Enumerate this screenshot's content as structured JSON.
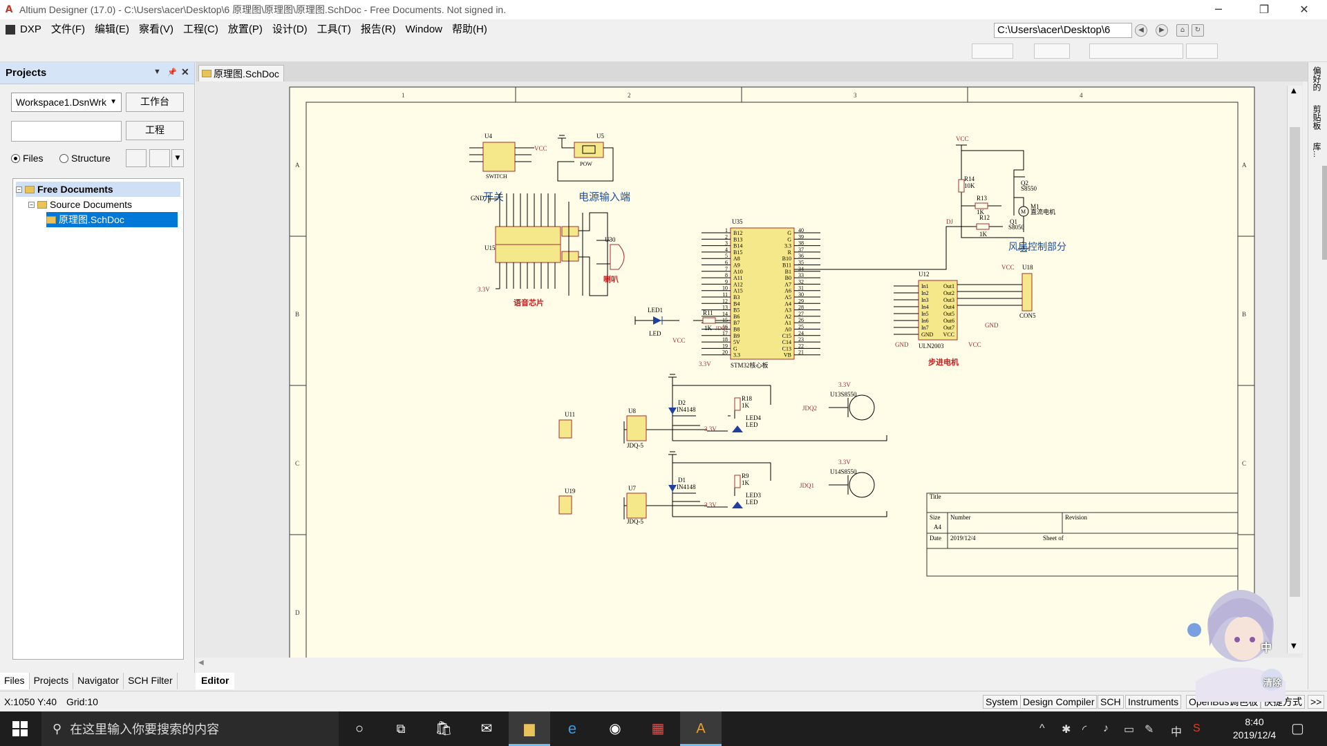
{
  "window": {
    "title": "Altium Designer (17.0) - C:\\Users\\acer\\Desktop\\6 原理图\\原理图\\原理图.SchDoc - Free Documents. Not signed in.",
    "controls": [
      "─",
      "❐",
      "✕"
    ]
  },
  "menu": {
    "dxp": "DXP",
    "items": [
      "文件(F)",
      "编辑(E)",
      "察看(V)",
      "工程(C)",
      "放置(P)",
      "设计(D)",
      "工具(T)",
      "报告(R)",
      "Window",
      "帮助(H)"
    ]
  },
  "path_combo": "C:\\Users\\acer\\Desktop\\6",
  "projects_panel": {
    "title": "Projects",
    "workspace": "Workspace1.DsnWrk",
    "workspace_button": "工作台",
    "project_button": "工程",
    "radio_files": "Files",
    "radio_structure": "Structure",
    "tree": [
      {
        "label": "Free Documents",
        "level": 0
      },
      {
        "label": "Source Documents",
        "level": 1
      },
      {
        "label": "原理图.SchDoc",
        "level": 2
      }
    ],
    "bottom_tabs": [
      "Files",
      "Projects",
      "Navigator",
      "SCH Filter"
    ]
  },
  "document": {
    "tab": "原理图.SchDoc",
    "editor_tab": "Editor",
    "zone_columns": [
      "1",
      "2",
      "3",
      "4"
    ],
    "zone_rows": [
      "A",
      "B",
      "C",
      "D"
    ]
  },
  "right_dock": {
    "tabs": [
      "偏好的",
      "剪贴板",
      "库..."
    ]
  },
  "schematic": {
    "labels": {
      "switch_caption": "开关",
      "power_caption": "电源输入端",
      "voice_caption": "语音芯片",
      "speaker_caption": "喇叭",
      "fan_caption": "风扇控制部分",
      "stepper_caption": "步进电机",
      "mcu_caption": "STM32核心板",
      "u4": "U4",
      "switch": "SWITCH",
      "vcc": "VCC",
      "u5": "U5",
      "pow": "POW",
      "gnd": "GND",
      "v33": "3.3V",
      "u15": "U15",
      "u30": "U30",
      "u35": "U35",
      "u12": "U12",
      "uln": "ULN2003",
      "u18": "U18",
      "con5": "CON5",
      "r14": "R14",
      "r14v": "10K",
      "r13": "R13",
      "r13v": "1K",
      "r12": "R12",
      "r12v": "1K",
      "q2": "Q2",
      "q2v": "S8550",
      "q1": "Q1",
      "q1v": "S8050",
      "m1": "M1",
      "m1v": "直流电机",
      "dj": "DJ",
      "led1": "LED1",
      "led": "LED",
      "r11": "R11",
      "r11v": "1K",
      "jdq1": "JDQ1",
      "jdq2": "JDQ2",
      "d2": "D2",
      "d1": "D1",
      "in4148": "IN4148",
      "r18": "R18",
      "r9": "R9",
      "r1k": "1K",
      "led4": "LED4",
      "led3": "LED3",
      "u13": "U13S8550",
      "u14": "U14S8550",
      "u8": "U8",
      "u7": "U7",
      "jdq5": "JDQ-5",
      "u11": "U11",
      "u19": "U19",
      "title": "Title",
      "size": "Size",
      "a4": "A4",
      "number": "Number",
      "revision": "Revision",
      "date": "Date",
      "date_val": "2019/12/4",
      "sheet": "Sheet  of"
    },
    "mcu_left_pins": [
      "B12",
      "B13",
      "B14",
      "B15",
      "A8",
      "A9",
      "A10",
      "A11",
      "A12",
      "A15",
      "B3",
      "B4",
      "B5",
      "B6",
      "B7",
      "B8",
      "B9",
      "5V",
      "G",
      "3.3"
    ],
    "mcu_right_pins": [
      "G",
      "G",
      "3.3",
      "R",
      "B10",
      "B11",
      "B1",
      "B0",
      "A7",
      "A6",
      "A5",
      "A4",
      "A3",
      "A2",
      "A1",
      "A0",
      "C15",
      "C14",
      "C13",
      "VB"
    ],
    "uln_left_pins": [
      "In1",
      "In2",
      "In3",
      "In4",
      "In5",
      "In6",
      "In7",
      "GND"
    ],
    "uln_right_pins": [
      "Out1",
      "Out2",
      "Out3",
      "Out4",
      "Out5",
      "Out6",
      "Out7",
      "VCC"
    ]
  },
  "status": {
    "coords": "X:1050 Y:40",
    "grid": "Grid:10",
    "tabs": [
      "System",
      "Design Compiler",
      "SCH",
      "Instruments",
      "OpenBus调色板",
      "快捷方式",
      ">>"
    ]
  },
  "widget": {
    "zhong": "中",
    "clear": "清除"
  },
  "taskbar": {
    "search_placeholder": "在这里输入你要搜索的内容",
    "time": "8:40",
    "date": "2019/12/4",
    "ime": "中"
  }
}
